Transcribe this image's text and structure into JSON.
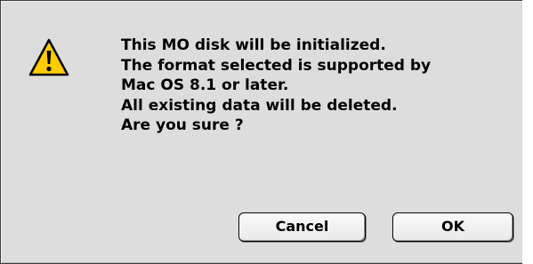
{
  "alert": {
    "icon": "warning-icon",
    "message_lines": [
      "This MO disk will be initialized.",
      "The format selected is supported by",
      "Mac OS 8.1 or later.",
      "All existing data will be deleted.",
      "Are you sure ?"
    ]
  },
  "buttons": {
    "cancel_label": "Cancel",
    "ok_label": "OK"
  },
  "colors": {
    "dialog_background": "#dddddd",
    "warning_yellow": "#ffcc00",
    "text": "#000000"
  }
}
